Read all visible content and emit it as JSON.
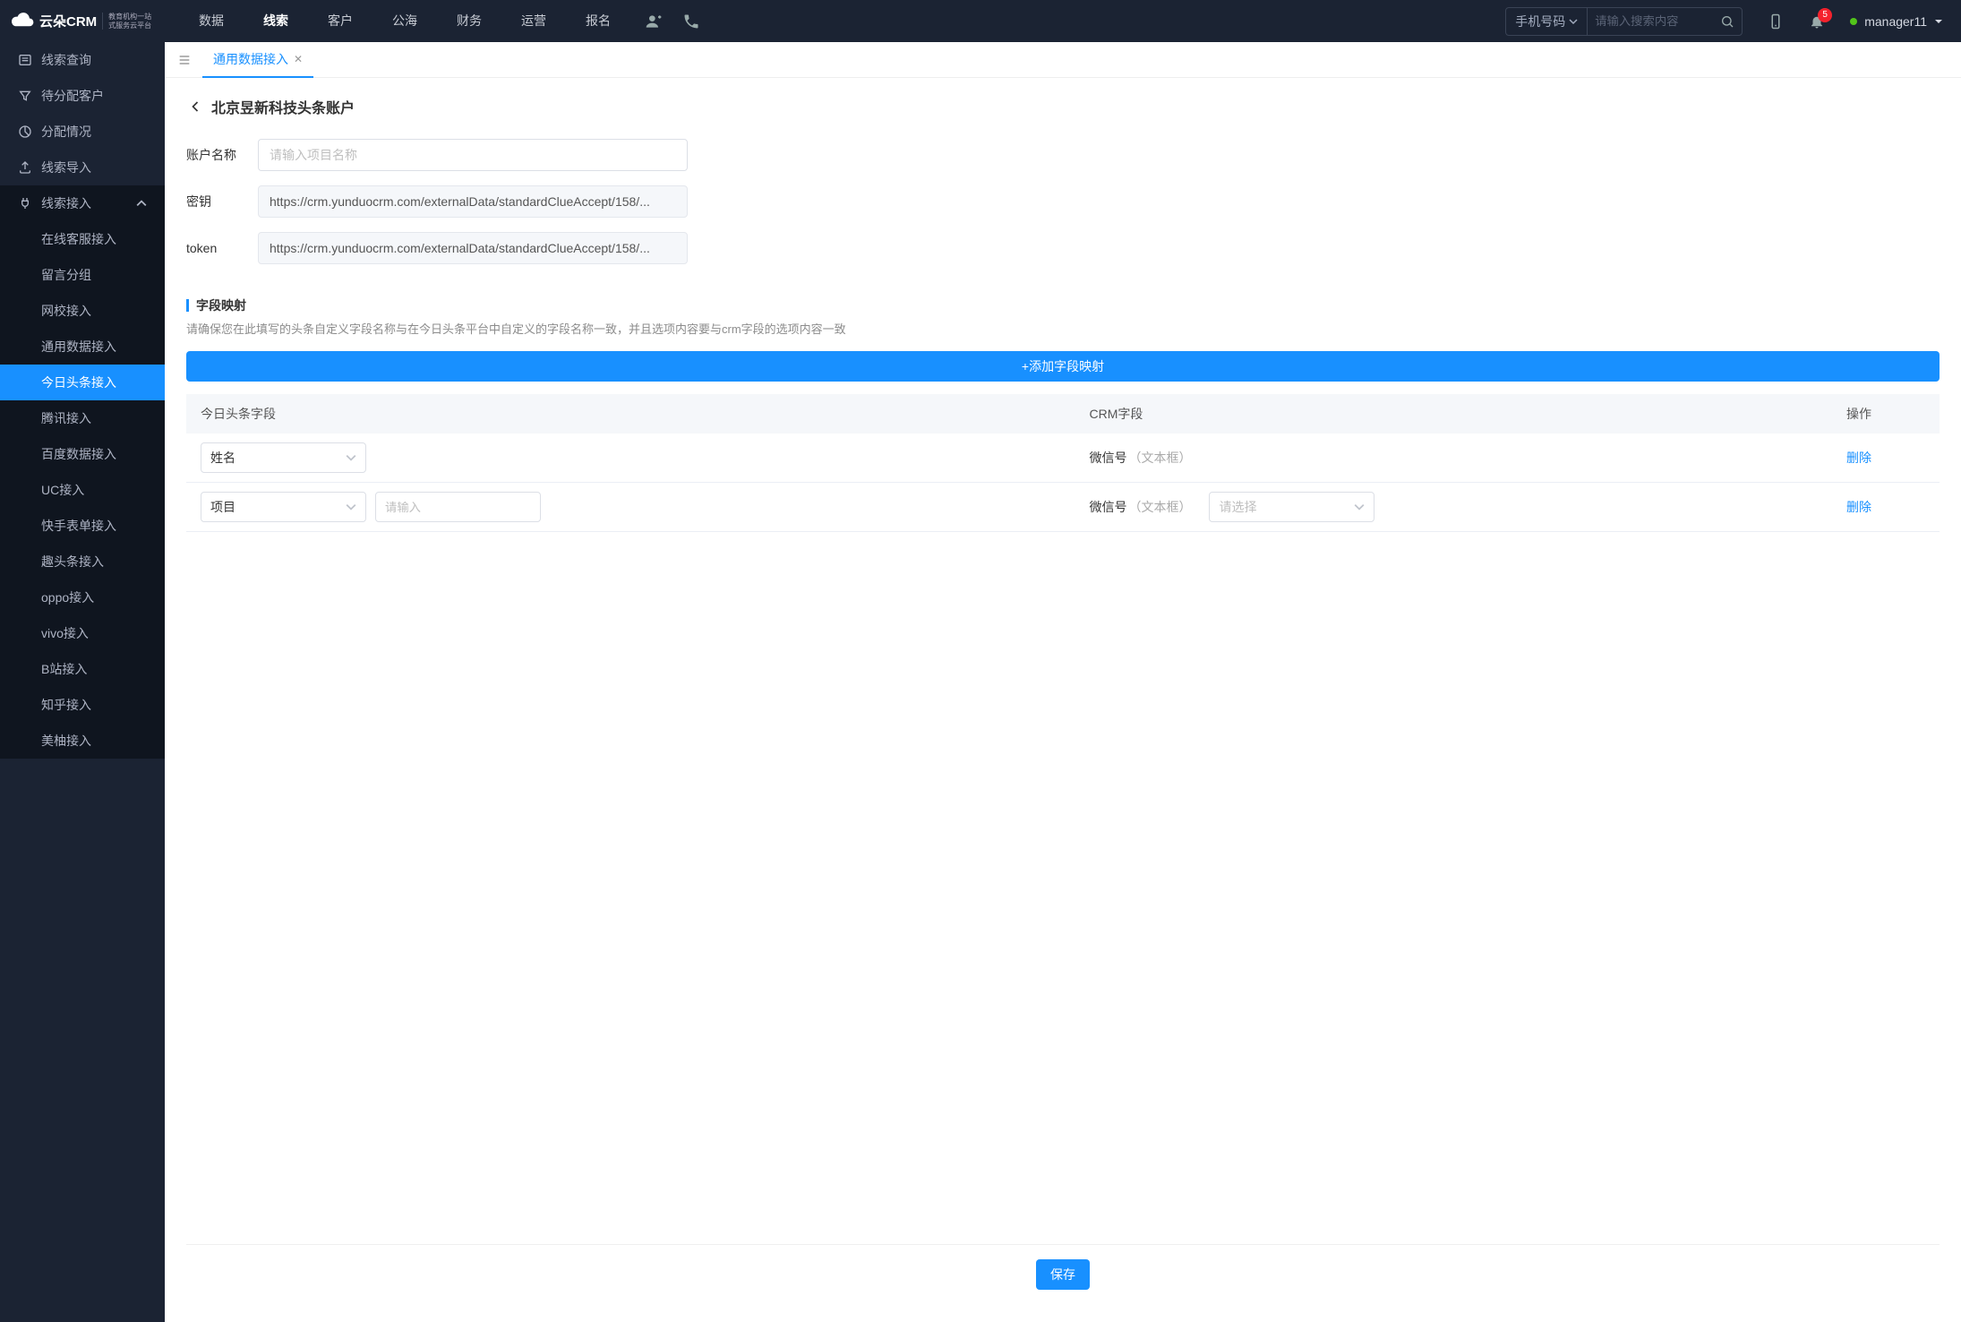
{
  "brand": {
    "name": "云朵CRM",
    "sub1": "教育机构一站",
    "sub2": "式服务云平台"
  },
  "nav": {
    "items": [
      "数据",
      "线索",
      "客户",
      "公海",
      "财务",
      "运营",
      "报名"
    ],
    "active": 1
  },
  "search": {
    "type": "手机号码",
    "placeholder": "请输入搜索内容"
  },
  "header": {
    "badge": "5",
    "user": "manager11"
  },
  "sidebar": {
    "items": [
      {
        "label": "线索查询",
        "icon": "list"
      },
      {
        "label": "待分配客户",
        "icon": "filter"
      },
      {
        "label": "分配情况",
        "icon": "pie"
      },
      {
        "label": "线索导入",
        "icon": "upload"
      },
      {
        "label": "线索接入",
        "icon": "plug",
        "expandable": true,
        "open": true
      }
    ],
    "subItems": [
      "在线客服接入",
      "留言分组",
      "网校接入",
      "通用数据接入",
      "今日头条接入",
      "腾讯接入",
      "百度数据接入",
      "UC接入",
      "快手表单接入",
      "趣头条接入",
      "oppo接入",
      "vivo接入",
      "B站接入",
      "知乎接入",
      "美柚接入"
    ],
    "subActive": 4
  },
  "tabs": {
    "items": [
      {
        "label": "通用数据接入"
      }
    ],
    "active": 0
  },
  "page": {
    "title": "北京昱新科技头条账户",
    "form": {
      "nameLabel": "账户名称",
      "namePlaceholder": "请输入项目名称",
      "secretLabel": "密钥",
      "secretValue": "https://crm.yunduocrm.com/externalData/standardClueAccept/158/...",
      "tokenLabel": "token",
      "tokenValue": "https://crm.yunduocrm.com/externalData/standardClueAccept/158/..."
    },
    "section": {
      "title": "字段映射",
      "hint": "请确保您在此填写的头条自定义字段名称与在今日头条平台中自定义的字段名称一致，并且选项内容要与crm字段的选项内容一致",
      "addBtn": "+添加字段映射"
    },
    "table": {
      "cols": [
        "今日头条字段",
        "CRM字段",
        "操作"
      ],
      "rows": [
        {
          "field": "姓名",
          "crm": "微信号",
          "crmType": "（文本框）",
          "hasSelect": false,
          "action": "删除"
        },
        {
          "field": "项目",
          "inputPlaceholder": "请输入",
          "crm": "微信号",
          "crmType": "（文本框）",
          "hasSelect": true,
          "selectPlaceholder": "请选择",
          "action": "删除"
        }
      ]
    },
    "saveBtn": "保存"
  }
}
